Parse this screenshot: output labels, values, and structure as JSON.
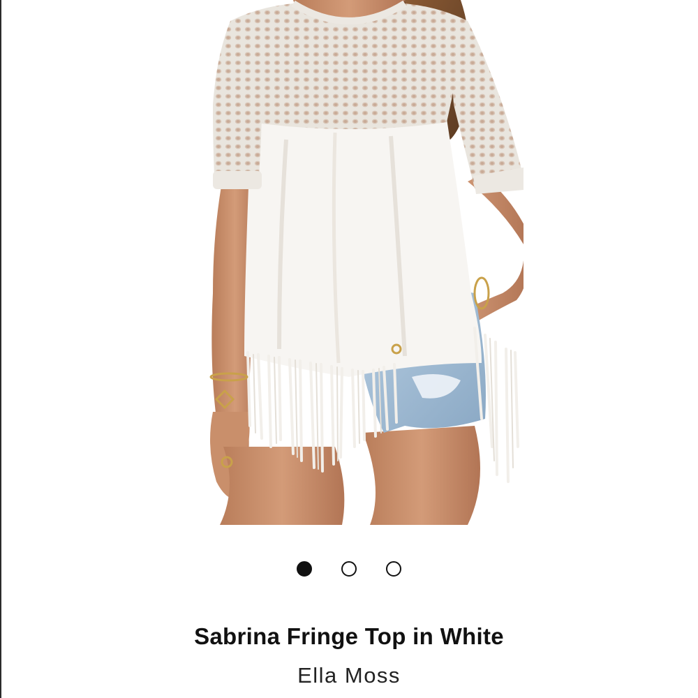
{
  "product": {
    "name": "Sabrina Fringe Top in White",
    "brand": "Ella Moss"
  },
  "carousel": {
    "total": 3,
    "active_index": 0
  },
  "colors": {
    "dot": "#111111",
    "garment": "#f7f5f2",
    "denim": "#a9c4dc",
    "skin": "#c98f6b"
  }
}
